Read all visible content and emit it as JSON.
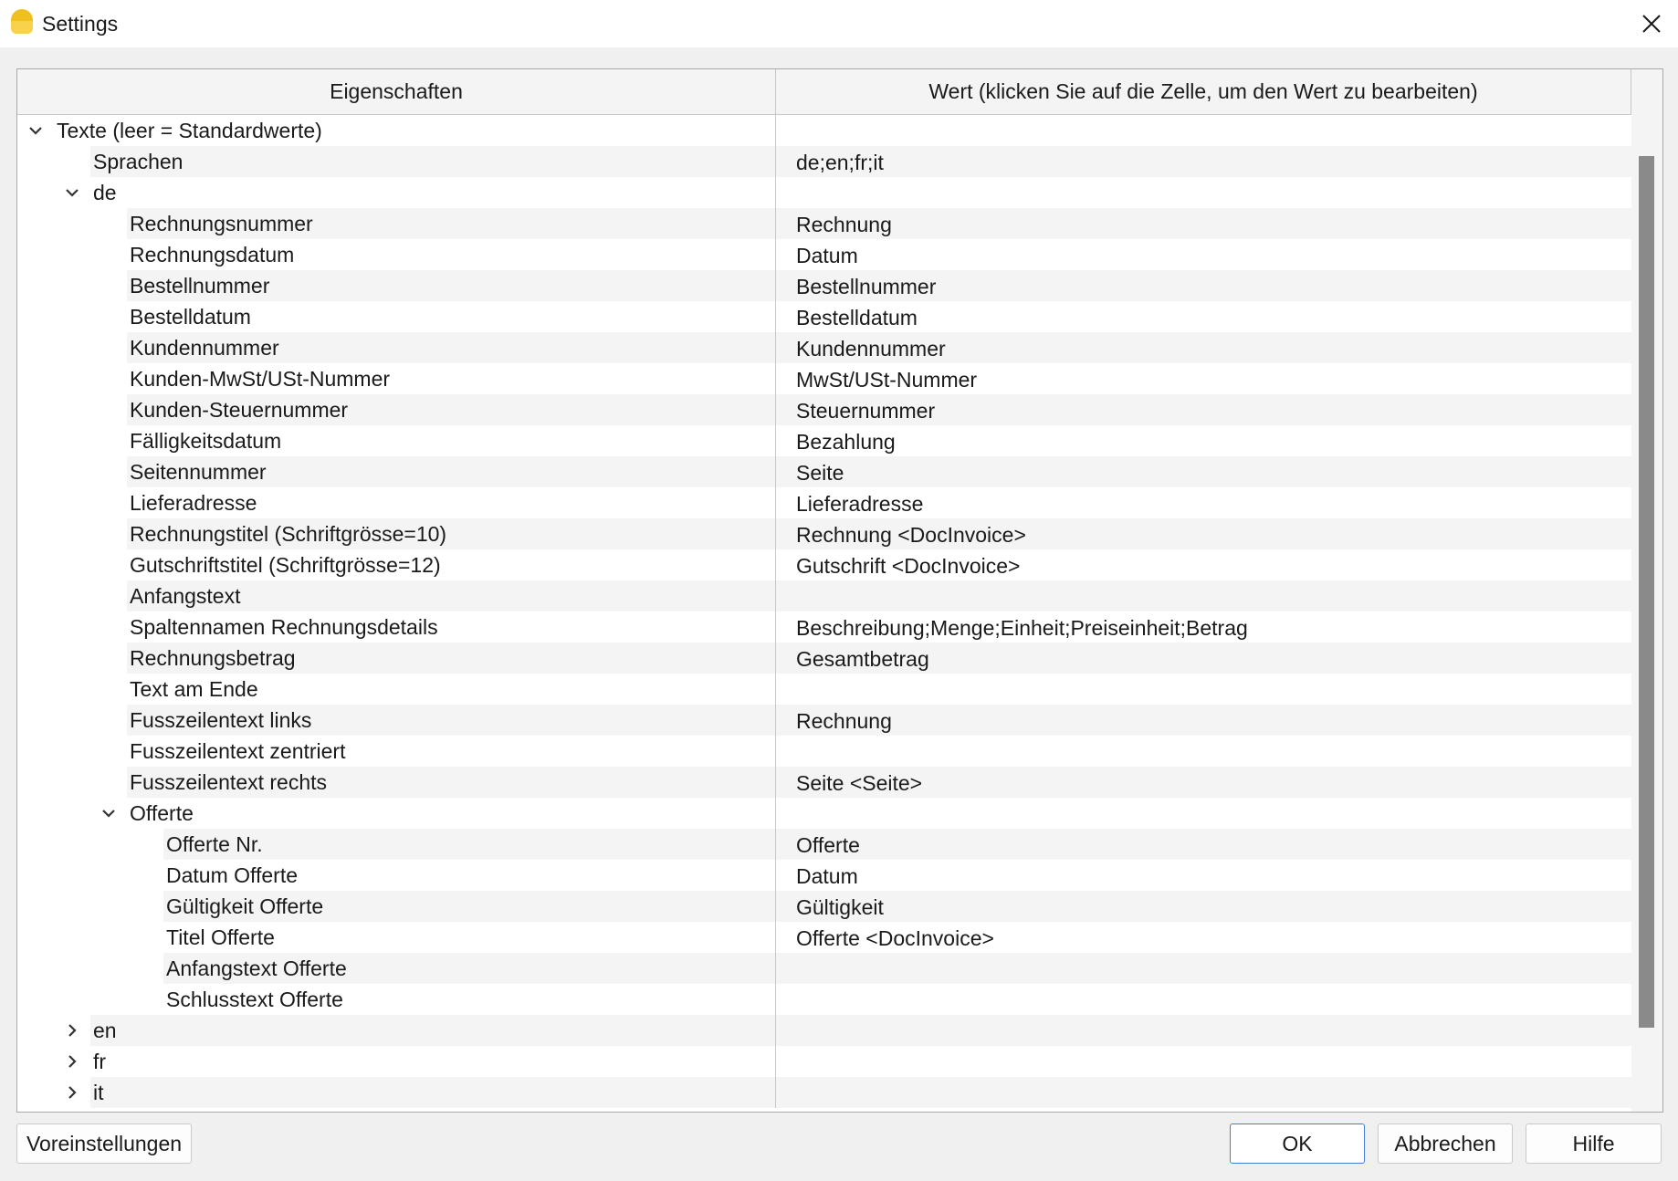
{
  "window": {
    "title": "Settings",
    "app_icon": "banana-app-icon",
    "close_icon": "close-icon"
  },
  "grid": {
    "headers": {
      "property": "Eigenschaften",
      "value": "Wert (klicken Sie auf die Zelle, um den Wert zu bearbeiten)"
    },
    "rows": [
      {
        "label": "Texte (leer = Standardwerte)",
        "value": "",
        "level": 0,
        "expander": "expanded"
      },
      {
        "label": "Sprachen",
        "value": "de;en;fr;it",
        "level": 1,
        "expander": "none"
      },
      {
        "label": "de",
        "value": "",
        "level": 1,
        "expander": "expanded"
      },
      {
        "label": "Rechnungsnummer",
        "value": "Rechnung",
        "level": 2,
        "expander": "none"
      },
      {
        "label": "Rechnungsdatum",
        "value": "Datum",
        "level": 2,
        "expander": "none"
      },
      {
        "label": "Bestellnummer",
        "value": "Bestellnummer",
        "level": 2,
        "expander": "none"
      },
      {
        "label": "Bestelldatum",
        "value": "Bestelldatum",
        "level": 2,
        "expander": "none"
      },
      {
        "label": "Kundennummer",
        "value": "Kundennummer",
        "level": 2,
        "expander": "none"
      },
      {
        "label": "Kunden-MwSt/USt-Nummer",
        "value": "MwSt/USt-Nummer",
        "level": 2,
        "expander": "none"
      },
      {
        "label": "Kunden-Steuernummer",
        "value": "Steuernummer",
        "level": 2,
        "expander": "none"
      },
      {
        "label": "Fälligkeitsdatum",
        "value": "Bezahlung",
        "level": 2,
        "expander": "none"
      },
      {
        "label": "Seitennummer",
        "value": "Seite",
        "level": 2,
        "expander": "none"
      },
      {
        "label": "Lieferadresse",
        "value": "Lieferadresse",
        "level": 2,
        "expander": "none"
      },
      {
        "label": "Rechnungstitel (Schriftgrösse=10)",
        "value": "Rechnung  <DocInvoice>",
        "level": 2,
        "expander": "none"
      },
      {
        "label": "Gutschriftstitel (Schriftgrösse=12)",
        "value": "Gutschrift  <DocInvoice>",
        "level": 2,
        "expander": "none"
      },
      {
        "label": "Anfangstext",
        "value": "",
        "level": 2,
        "expander": "none"
      },
      {
        "label": "Spaltennamen Rechnungsdetails",
        "value": "Beschreibung;Menge;Einheit;Preiseinheit;Betrag",
        "level": 2,
        "expander": "none"
      },
      {
        "label": "Rechnungsbetrag",
        "value": "Gesamtbetrag",
        "level": 2,
        "expander": "none"
      },
      {
        "label": "Text am Ende",
        "value": "",
        "level": 2,
        "expander": "none"
      },
      {
        "label": "Fusszeilentext links",
        "value": "Rechnung",
        "level": 2,
        "expander": "none"
      },
      {
        "label": "Fusszeilentext zentriert",
        "value": "",
        "level": 2,
        "expander": "none"
      },
      {
        "label": "Fusszeilentext rechts",
        "value": "Seite  <Seite>",
        "level": 2,
        "expander": "none"
      },
      {
        "label": "Offerte",
        "value": "",
        "level": 2,
        "expander": "expanded"
      },
      {
        "label": "Offerte Nr.",
        "value": "Offerte",
        "level": 3,
        "expander": "none"
      },
      {
        "label": "Datum Offerte",
        "value": "Datum",
        "level": 3,
        "expander": "none"
      },
      {
        "label": "Gültigkeit Offerte",
        "value": "Gültigkeit",
        "level": 3,
        "expander": "none"
      },
      {
        "label": "Titel Offerte",
        "value": "Offerte  <DocInvoice>",
        "level": 3,
        "expander": "none"
      },
      {
        "label": "Anfangstext Offerte",
        "value": "",
        "level": 3,
        "expander": "none"
      },
      {
        "label": "Schlusstext Offerte",
        "value": "",
        "level": 3,
        "expander": "none"
      },
      {
        "label": "en",
        "value": "",
        "level": 1,
        "expander": "collapsed"
      },
      {
        "label": "fr",
        "value": "",
        "level": 1,
        "expander": "collapsed"
      },
      {
        "label": "it",
        "value": "",
        "level": 1,
        "expander": "collapsed"
      }
    ]
  },
  "buttons": {
    "defaults": "Voreinstellungen",
    "ok": "OK",
    "cancel": "Abbrechen",
    "help": "Hilfe"
  },
  "colors": {
    "primary_border": "#3f7ed6",
    "alt_row": "#f4f4f4",
    "scroll_thumb": "#8a8a8a"
  }
}
